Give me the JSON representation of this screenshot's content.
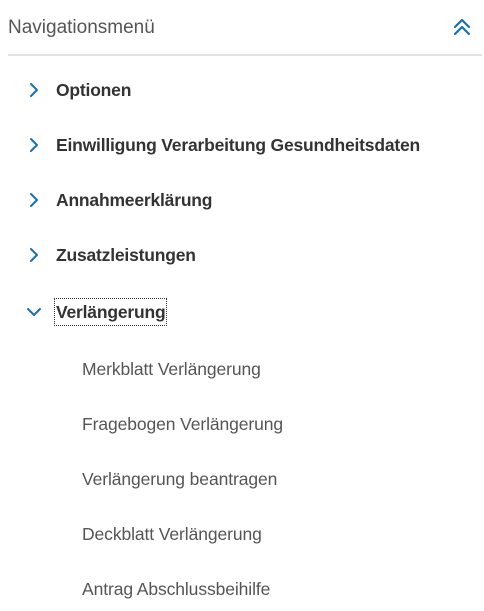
{
  "nav": {
    "title": "Navigationsmenü",
    "collapse_icon": "double-chevron-up-icon",
    "accent_color": "#1a6fb0",
    "items": [
      {
        "label": "Optionen",
        "expanded": false,
        "icon": "chevron-right-icon"
      },
      {
        "label": "Einwilligung Verarbeitung Gesundheitsdaten",
        "expanded": false,
        "icon": "chevron-right-icon"
      },
      {
        "label": "Annahmeerklärung",
        "expanded": false,
        "icon": "chevron-right-icon"
      },
      {
        "label": "Zusatzleistungen",
        "expanded": false,
        "icon": "chevron-right-icon"
      },
      {
        "label": "Verlängerung",
        "expanded": true,
        "icon": "chevron-down-icon"
      }
    ],
    "subitems": [
      {
        "label": "Merkblatt Verlängerung"
      },
      {
        "label": "Fragebogen Verlängerung"
      },
      {
        "label": "Verlängerung beantragen"
      },
      {
        "label": "Deckblatt Verlängerung"
      },
      {
        "label": "Antrag Abschlussbeihilfe"
      }
    ]
  }
}
